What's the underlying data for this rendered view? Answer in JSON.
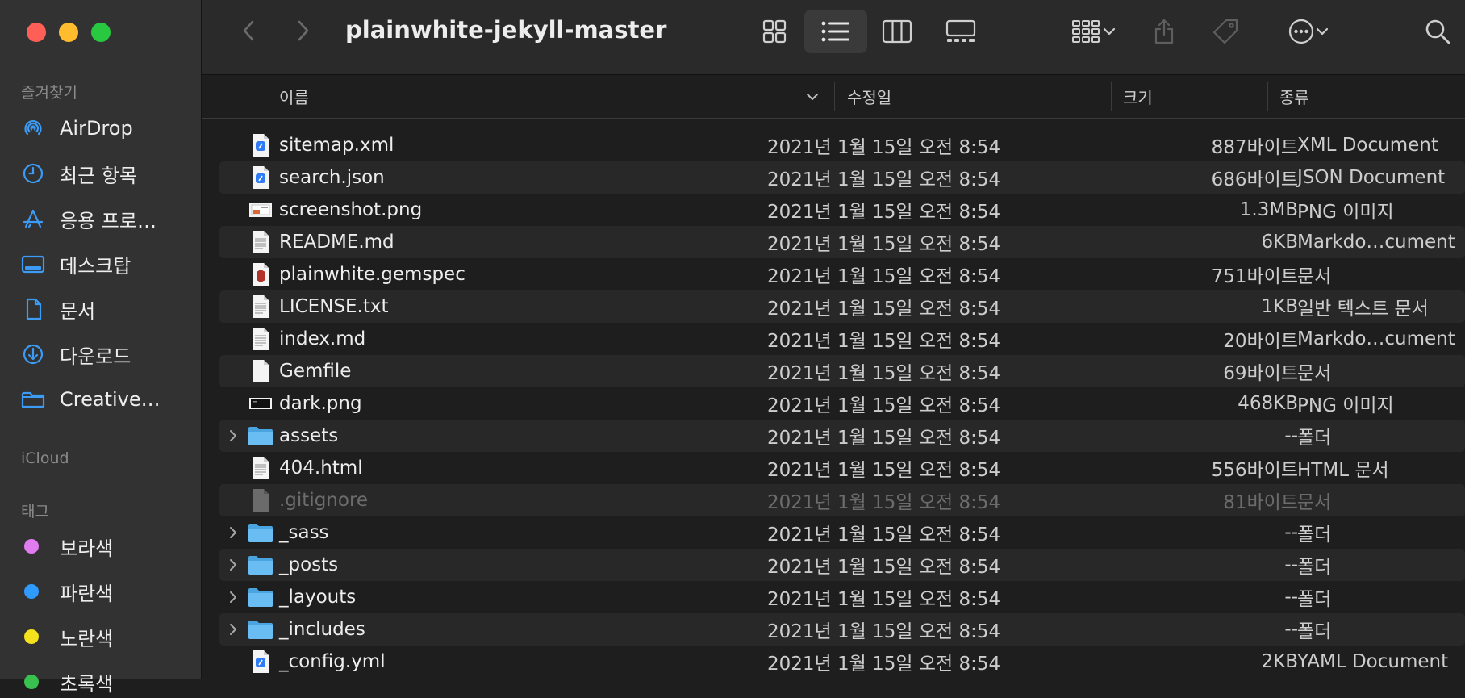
{
  "window": {
    "title": "plainwhite-jekyll-master"
  },
  "sidebar": {
    "favorites_title": "즐겨찾기",
    "favorites": [
      {
        "label": "AirDrop",
        "icon": "airdrop-icon"
      },
      {
        "label": "최근 항목",
        "icon": "clock-icon"
      },
      {
        "label": "응용 프로…",
        "icon": "applications-icon"
      },
      {
        "label": "데스크탑",
        "icon": "desktop-icon"
      },
      {
        "label": "문서",
        "icon": "document-icon"
      },
      {
        "label": "다운로드",
        "icon": "download-icon"
      },
      {
        "label": "Creative…",
        "icon": "folder-icon"
      }
    ],
    "icloud_title": "iCloud",
    "tags_title": "태그",
    "tags": [
      {
        "label": "보라색",
        "color": "#e17bf0"
      },
      {
        "label": "파란색",
        "color": "#2e9bff"
      },
      {
        "label": "노란색",
        "color": "#f5e21c"
      },
      {
        "label": "초록색",
        "color": "#39c14f"
      }
    ]
  },
  "columns": {
    "name": "이름",
    "modified": "수정일",
    "size": "크기",
    "kind": "종류"
  },
  "files": [
    {
      "name": "sitemap.xml",
      "date": "2021년 1월 15일 오전 8:54",
      "size": "887바이트",
      "kind": "XML Document",
      "icon": "xml-file-icon",
      "folder": false,
      "dim": false
    },
    {
      "name": "search.json",
      "date": "2021년 1월 15일 오전 8:54",
      "size": "686바이트",
      "kind": "JSON Document",
      "icon": "json-file-icon",
      "folder": false,
      "dim": false
    },
    {
      "name": "screenshot.png",
      "date": "2021년 1월 15일 오전 8:54",
      "size": "1.3MB",
      "kind": "PNG 이미지",
      "icon": "image-file-icon",
      "folder": false,
      "dim": false
    },
    {
      "name": "README.md",
      "date": "2021년 1월 15일 오전 8:54",
      "size": "6KB",
      "kind": "Markdo…cument",
      "icon": "text-file-icon",
      "folder": false,
      "dim": false
    },
    {
      "name": "plainwhite.gemspec",
      "date": "2021년 1월 15일 오전 8:54",
      "size": "751바이트",
      "kind": "문서",
      "icon": "ruby-file-icon",
      "folder": false,
      "dim": false
    },
    {
      "name": "LICENSE.txt",
      "date": "2021년 1월 15일 오전 8:54",
      "size": "1KB",
      "kind": "일반 텍스트 문서",
      "icon": "text-file-icon",
      "folder": false,
      "dim": false
    },
    {
      "name": "index.md",
      "date": "2021년 1월 15일 오전 8:54",
      "size": "20바이트",
      "kind": "Markdo…cument",
      "icon": "text-file-icon",
      "folder": false,
      "dim": false
    },
    {
      "name": "Gemfile",
      "date": "2021년 1월 15일 오전 8:54",
      "size": "69바이트",
      "kind": "문서",
      "icon": "blank-file-icon",
      "folder": false,
      "dim": false
    },
    {
      "name": "dark.png",
      "date": "2021년 1월 15일 오전 8:54",
      "size": "468KB",
      "kind": "PNG 이미지",
      "icon": "dark-image-file-icon",
      "folder": false,
      "dim": false
    },
    {
      "name": "assets",
      "date": "2021년 1월 15일 오전 8:54",
      "size": "--",
      "kind": "폴더",
      "icon": "folder-icon",
      "folder": true,
      "dim": false
    },
    {
      "name": "404.html",
      "date": "2021년 1월 15일 오전 8:54",
      "size": "556바이트",
      "kind": "HTML 문서",
      "icon": "text-file-icon",
      "folder": false,
      "dim": false
    },
    {
      "name": ".gitignore",
      "date": "2021년 1월 15일 오전 8:54",
      "size": "81바이트",
      "kind": "문서",
      "icon": "hidden-file-icon",
      "folder": false,
      "dim": true
    },
    {
      "name": "_sass",
      "date": "2021년 1월 15일 오전 8:54",
      "size": "--",
      "kind": "폴더",
      "icon": "folder-icon",
      "folder": true,
      "dim": false
    },
    {
      "name": "_posts",
      "date": "2021년 1월 15일 오전 8:54",
      "size": "--",
      "kind": "폴더",
      "icon": "folder-icon",
      "folder": true,
      "dim": false
    },
    {
      "name": "_layouts",
      "date": "2021년 1월 15일 오전 8:54",
      "size": "--",
      "kind": "폴더",
      "icon": "folder-icon",
      "folder": true,
      "dim": false
    },
    {
      "name": "_includes",
      "date": "2021년 1월 15일 오전 8:54",
      "size": "--",
      "kind": "폴더",
      "icon": "folder-icon",
      "folder": true,
      "dim": false
    },
    {
      "name": "_config.yml",
      "date": "2021년 1월 15일 오전 8:54",
      "size": "2KB",
      "kind": "YAML Document",
      "icon": "yaml-file-icon",
      "folder": false,
      "dim": false
    }
  ],
  "colors": {
    "accent": "#3b9bf5",
    "folder": "#5fb4ec",
    "close": "#ff5f57",
    "minimize": "#febc2e",
    "zoom": "#28c840"
  }
}
